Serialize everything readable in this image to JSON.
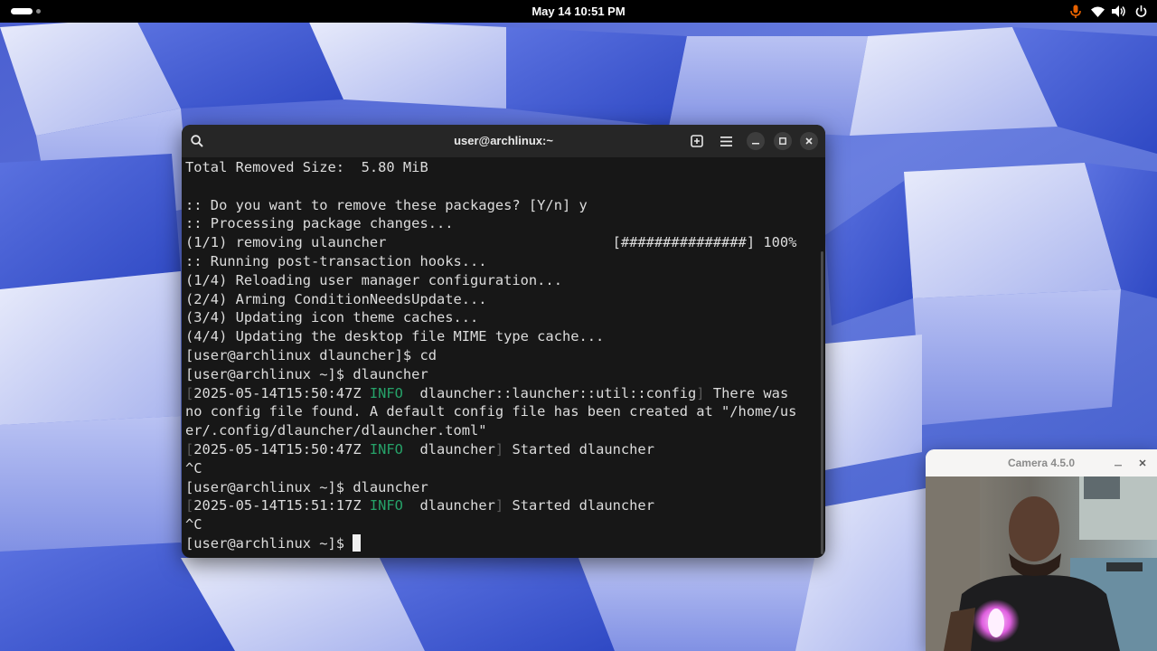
{
  "topbar": {
    "clock": "May 14  10:51 PM",
    "tray_icons": [
      "microphone-icon",
      "wifi-icon",
      "volume-icon",
      "power-icon"
    ],
    "mic_color": "#e66100"
  },
  "terminal": {
    "title": "user@archlinux:~",
    "header_buttons": [
      "search-icon",
      "new-tab-icon",
      "menu-icon",
      "minimize-icon",
      "maximize-icon",
      "close-icon"
    ],
    "lines": [
      {
        "parts": [
          {
            "t": "Total Removed Size:  5.80 MiB"
          }
        ]
      },
      {
        "parts": [
          {
            "t": ""
          }
        ]
      },
      {
        "parts": [
          {
            "t": ":: Do you want to remove these packages? [Y/n] y"
          }
        ]
      },
      {
        "parts": [
          {
            "t": ":: Processing package changes..."
          }
        ]
      },
      {
        "parts": [
          {
            "t": "(1/1) removing ulauncher                           [###############] 100%"
          }
        ]
      },
      {
        "parts": [
          {
            "t": ":: Running post-transaction hooks..."
          }
        ]
      },
      {
        "parts": [
          {
            "t": "(1/4) Reloading user manager configuration..."
          }
        ]
      },
      {
        "parts": [
          {
            "t": "(2/4) Arming ConditionNeedsUpdate..."
          }
        ]
      },
      {
        "parts": [
          {
            "t": "(3/4) Updating icon theme caches..."
          }
        ]
      },
      {
        "parts": [
          {
            "t": "(4/4) Updating the desktop file MIME type cache..."
          }
        ]
      },
      {
        "parts": [
          {
            "t": "[user@archlinux dlauncher]$ cd"
          }
        ]
      },
      {
        "parts": [
          {
            "t": "[user@archlinux ~]$ dlauncher"
          }
        ]
      },
      {
        "parts": [
          {
            "t": "[",
            "c": "dim"
          },
          {
            "t": "2025-05-14T15:50:47Z "
          },
          {
            "t": "INFO",
            "c": "grn"
          },
          {
            "t": "  dlauncher::launcher::util::config"
          },
          {
            "t": "]",
            "c": "dim"
          },
          {
            "t": " There was"
          }
        ]
      },
      {
        "parts": [
          {
            "t": "no config file found. A default config file has been created at \"/home/us"
          }
        ]
      },
      {
        "parts": [
          {
            "t": "er/.config/dlauncher/dlauncher.toml\""
          }
        ]
      },
      {
        "parts": [
          {
            "t": "[",
            "c": "dim"
          },
          {
            "t": "2025-05-14T15:50:47Z "
          },
          {
            "t": "INFO",
            "c": "grn"
          },
          {
            "t": "  dlauncher"
          },
          {
            "t": "]",
            "c": "dim"
          },
          {
            "t": " Started dlauncher"
          }
        ]
      },
      {
        "parts": [
          {
            "t": "^C"
          }
        ]
      },
      {
        "parts": [
          {
            "t": "[user@archlinux ~]$ dlauncher"
          }
        ]
      },
      {
        "parts": [
          {
            "t": "[",
            "c": "dim"
          },
          {
            "t": "2025-05-14T15:51:17Z "
          },
          {
            "t": "INFO",
            "c": "grn"
          },
          {
            "t": "  dlauncher"
          },
          {
            "t": "]",
            "c": "dim"
          },
          {
            "t": " Started dlauncher"
          }
        ]
      },
      {
        "parts": [
          {
            "t": "^C"
          }
        ]
      },
      {
        "parts": [
          {
            "t": "[user@archlinux ~]$ "
          }
        ],
        "cursor": true
      }
    ]
  },
  "camera": {
    "title": "Camera 4.5.0",
    "header_buttons": [
      "minimize-icon",
      "close-icon"
    ]
  }
}
